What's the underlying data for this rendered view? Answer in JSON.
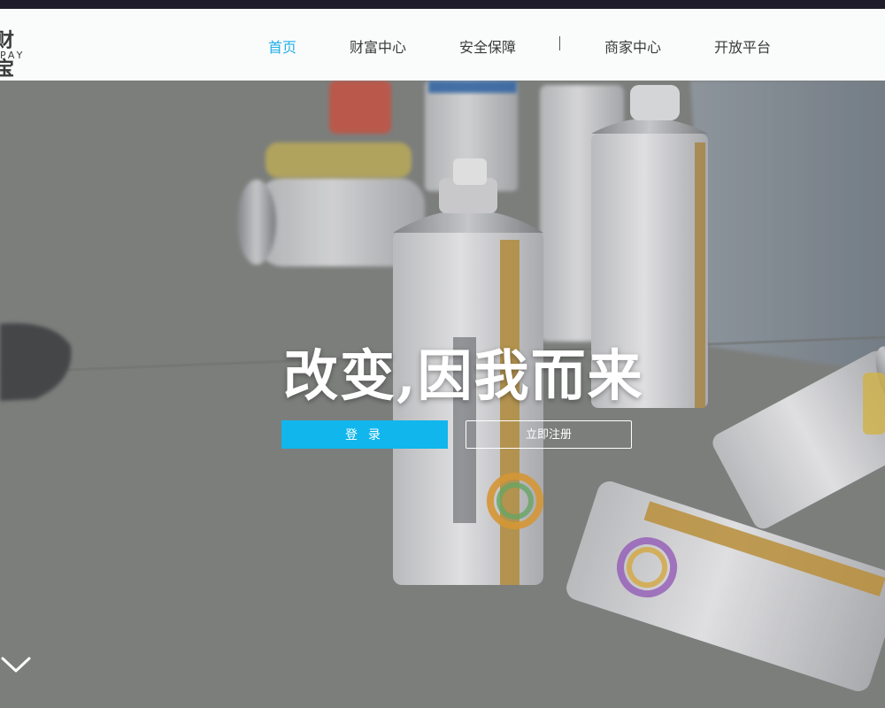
{
  "logo": {
    "cn": "财宝",
    "en": "PAY"
  },
  "nav": {
    "items": [
      {
        "label": "首页",
        "active": true
      },
      {
        "label": "财富中心",
        "active": false
      },
      {
        "label": "安全保障",
        "active": false
      },
      {
        "label": "商家中心",
        "active": false
      },
      {
        "label": "开放平台",
        "active": false
      }
    ]
  },
  "hero": {
    "slogan": "改变,因我而来",
    "login_label": "登 录",
    "register_label": "立即注册"
  },
  "colors": {
    "accent": "#22b0e6",
    "login_button": "#11b6ec",
    "topbar": "#1f1d2b"
  }
}
